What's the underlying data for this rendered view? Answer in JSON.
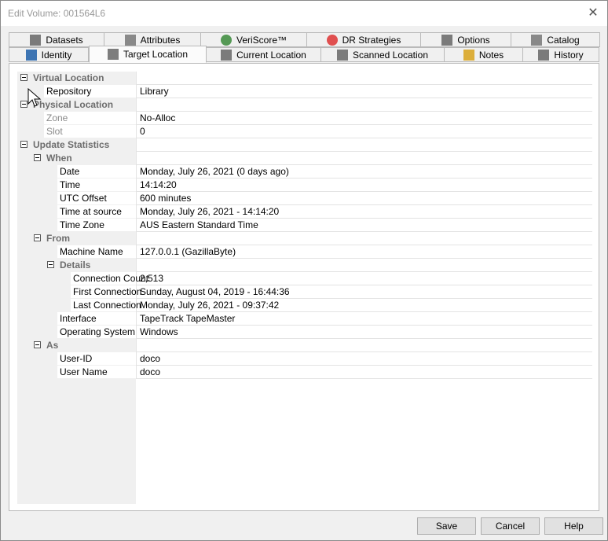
{
  "window": {
    "title": "Edit Volume: 001564L6",
    "close_glyph": "✕"
  },
  "tabs_top": [
    {
      "label": "Datasets",
      "icon": "document-icon"
    },
    {
      "label": "Attributes",
      "icon": "document-lines-icon"
    },
    {
      "label": "VeriScore™",
      "icon": "pie-chart-icon"
    },
    {
      "label": "DR Strategies",
      "icon": "lifebuoy-icon"
    },
    {
      "label": "Options",
      "icon": "gear-icon"
    },
    {
      "label": "Catalog",
      "icon": "database-icon"
    }
  ],
  "tabs_bottom": [
    {
      "label": "Identity",
      "icon": "tape-icon"
    },
    {
      "label": "Target Location",
      "icon": "robot-icon",
      "active": true
    },
    {
      "label": "Current Location",
      "icon": "robot-icon"
    },
    {
      "label": "Scanned Location",
      "icon": "robot-icon"
    },
    {
      "label": "Notes",
      "icon": "pencil-icon"
    },
    {
      "label": "History",
      "icon": "calendar-icon"
    }
  ],
  "properties": [
    {
      "label": "Virtual Location",
      "level": 0,
      "category": true,
      "value": ""
    },
    {
      "label": "Repository",
      "level": 1,
      "value": "Library"
    },
    {
      "label": "Physical Location",
      "level": 0,
      "category": true,
      "value": ""
    },
    {
      "label": "Zone",
      "level": 1,
      "dim": true,
      "value": "No-Alloc"
    },
    {
      "label": "Slot",
      "level": 1,
      "dim": true,
      "value": "0"
    },
    {
      "label": "Update Statistics",
      "level": 0,
      "category": true,
      "value": ""
    },
    {
      "label": "When",
      "level": 1,
      "category": true,
      "value": ""
    },
    {
      "label": "Date",
      "level": 2,
      "value": "Monday, July 26, 2021 (0 days ago)"
    },
    {
      "label": "Time",
      "level": 2,
      "value": "14:14:20"
    },
    {
      "label": "UTC Offset",
      "level": 2,
      "value": "600 minutes"
    },
    {
      "label": "Time at source",
      "level": 2,
      "value": "Monday, July 26, 2021 - 14:14:20"
    },
    {
      "label": "Time Zone",
      "level": 2,
      "value": "AUS Eastern Standard Time"
    },
    {
      "label": "From",
      "level": 1,
      "category": true,
      "value": ""
    },
    {
      "label": "Machine Name",
      "level": 2,
      "value": "127.0.0.1 (GazillaByte)"
    },
    {
      "label": "Details",
      "level": 2,
      "category": true,
      "value": ""
    },
    {
      "label": "Connection Count",
      "level": 3,
      "value": "2,513"
    },
    {
      "label": "First Connection",
      "level": 3,
      "value": "Sunday, August 04, 2019 - 16:44:36"
    },
    {
      "label": "Last Connection",
      "level": 3,
      "value": "Monday, July 26, 2021 - 09:37:42"
    },
    {
      "label": "Interface",
      "level": 2,
      "value": "TapeTrack TapeMaster"
    },
    {
      "label": "Operating System",
      "level": 2,
      "value": "Windows"
    },
    {
      "label": "As",
      "level": 1,
      "category": true,
      "value": ""
    },
    {
      "label": "User-ID",
      "level": 2,
      "value": "doco"
    },
    {
      "label": "User Name",
      "level": 2,
      "value": "doco"
    }
  ],
  "buttons": {
    "save": "Save",
    "cancel": "Cancel",
    "help": "Help"
  }
}
